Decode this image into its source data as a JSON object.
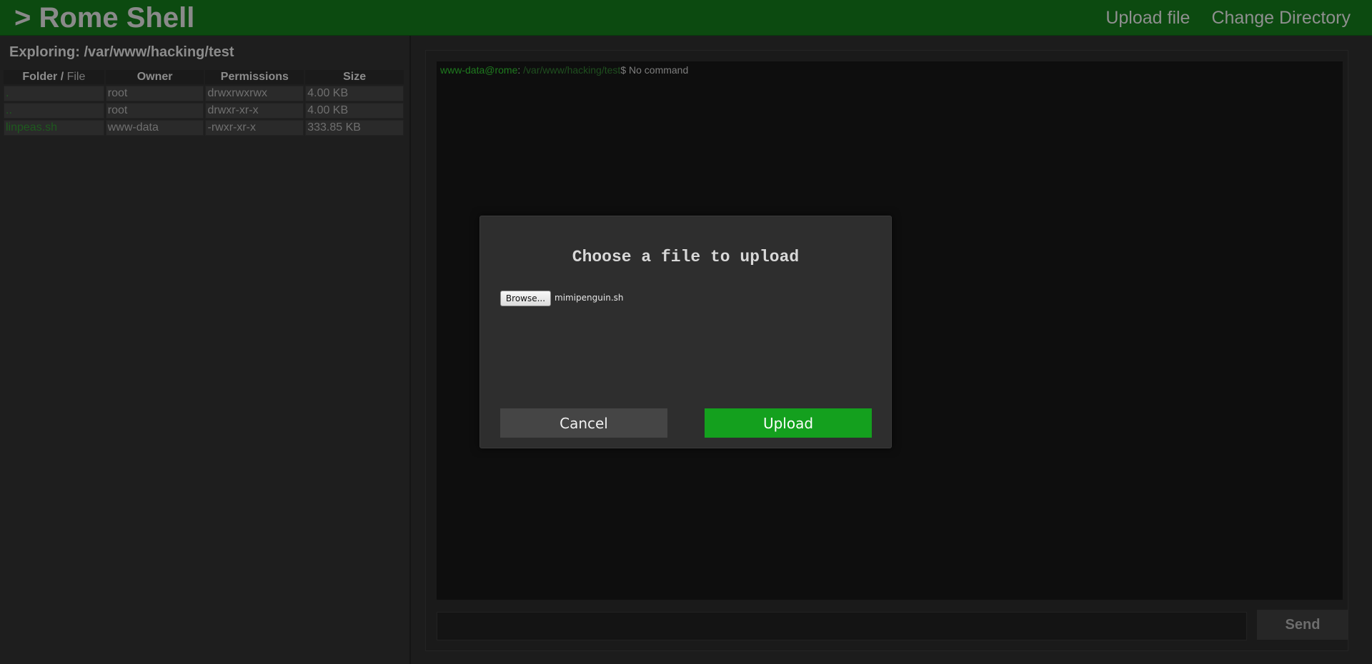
{
  "header": {
    "logo": "> Rome Shell",
    "nav": {
      "upload_file": "Upload file",
      "change_directory": "Change Directory"
    }
  },
  "explorer": {
    "title": "Exploring: /var/www/hacking/test",
    "columns": {
      "folder": "Folder",
      "separator": " / ",
      "file": "File",
      "owner": "Owner",
      "permissions": "Permissions",
      "size": "Size"
    },
    "rows": [
      {
        "name": ".",
        "owner": "root",
        "permissions": "drwxrwxrwx",
        "size": "4.00 KB"
      },
      {
        "name": "..",
        "owner": "root",
        "permissions": "drwxr-xr-x",
        "size": "4.00 KB"
      },
      {
        "name": "linpeas.sh",
        "owner": "www-data",
        "permissions": "-rwxr-xr-x",
        "size": "333.85 KB"
      }
    ]
  },
  "terminal": {
    "user": "www-data@rome",
    "colon": ":",
    "path": " /var/www/hacking/test",
    "dollar": "$",
    "output": " No command",
    "input_value": "",
    "send_label": "Send"
  },
  "modal": {
    "title": "Choose a file to upload",
    "browse_label": "Browse...",
    "selected_file": "mimipenguin.sh",
    "cancel_label": "Cancel",
    "upload_label": "Upload"
  },
  "colors": {
    "header_bg": "#0c4a10",
    "accent_green": "#14a01e",
    "terminal_bg": "#0e0e0e"
  }
}
